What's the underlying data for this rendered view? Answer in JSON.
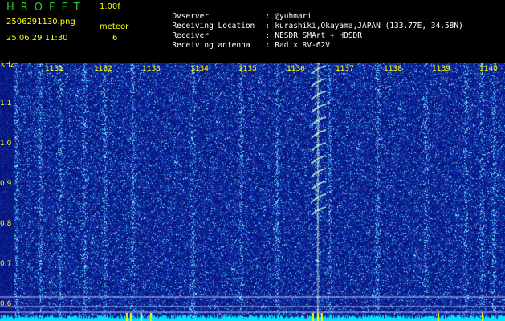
{
  "header": {
    "app_title": "HROFFT",
    "version": "1.00f",
    "filename": "2506291130.png",
    "datetime": "25.06.29 11:30",
    "mode_label": "meteor",
    "mode_value": "6"
  },
  "info": [
    {
      "key": "Ovserver",
      "value": "@yuhmari"
    },
    {
      "key": "Receiving Location",
      "value": "kurashiki,Okayama,JAPAN (133.77E, 34.58N)"
    },
    {
      "key": "Receiver",
      "value": "NESDR SMArt + HDSDR"
    },
    {
      "key": "Receiving antenna",
      "value": "Radix RV-62V"
    }
  ],
  "axis": {
    "y_unit": "kHz",
    "y_ticks": [
      "1.1",
      "1.0",
      "0.9",
      "0.8",
      "0.7",
      "0.6"
    ],
    "x_ticks": [
      "1131",
      "1132",
      "1133",
      "1134",
      "1135",
      "1136",
      "1137",
      "1138",
      "1139",
      "1140"
    ]
  },
  "colors": {
    "background": "#000000",
    "spectrogram_base": "#0a1a8c",
    "label_yellow": "#ffff00",
    "title_green": "#2ecc2e",
    "signal_trace": "#00e5ff"
  }
}
